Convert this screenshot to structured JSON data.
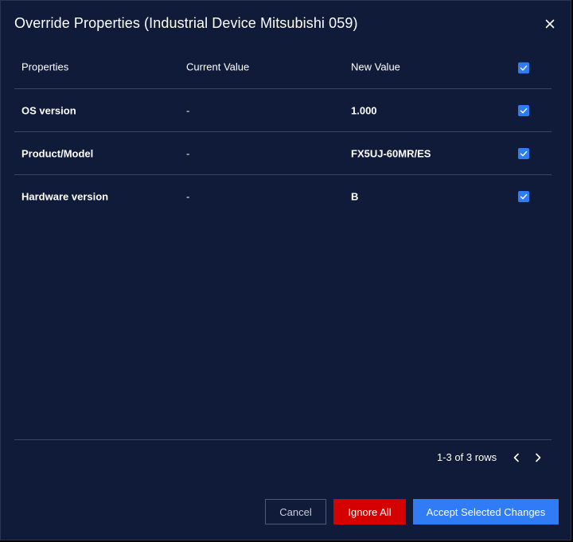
{
  "dialog": {
    "title": "Override Properties  (Industrial Device Mitsubishi 059)",
    "close_icon": "close-icon"
  },
  "table": {
    "headers": {
      "properties": "Properties",
      "current_value": "Current Value",
      "new_value": "New Value",
      "select_all_checked": true
    },
    "rows": [
      {
        "property": "OS version",
        "current_value": "-",
        "new_value": "1.000",
        "checked": true
      },
      {
        "property": "Product/Model",
        "current_value": "-",
        "new_value": "FX5UJ-60MR/ES",
        "checked": true
      },
      {
        "property": "Hardware version",
        "current_value": "-",
        "new_value": "B",
        "checked": true
      }
    ]
  },
  "pagination": {
    "summary": "1-3 of 3 rows",
    "prev_icon": "chevron-left-icon",
    "next_icon": "chevron-right-icon"
  },
  "buttons": {
    "cancel": "Cancel",
    "ignore_all": "Ignore All",
    "accept": "Accept Selected Changes"
  },
  "colors": {
    "background": "#101b3a",
    "accent": "#2f7cf6",
    "danger": "#d50000",
    "divider": "#3a4563"
  }
}
